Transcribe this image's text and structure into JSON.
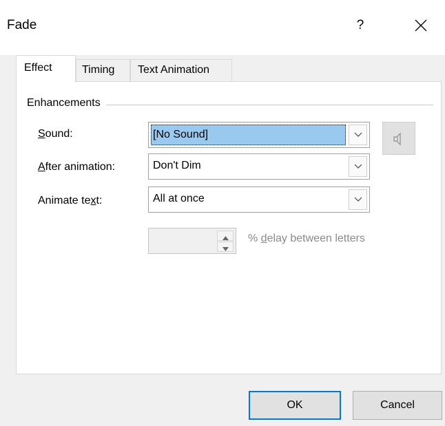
{
  "window": {
    "title": "Fade",
    "help_label": "?",
    "close_icon": "close-icon"
  },
  "tabs": [
    {
      "label": "Effect",
      "active": true
    },
    {
      "label": "Timing",
      "active": false
    },
    {
      "label": "Text Animation",
      "active": false
    }
  ],
  "enhancements": {
    "group_label": "Enhancements",
    "sound": {
      "label_prefix": "",
      "label_access": "S",
      "label_rest": "ound:",
      "value": "[No Sound]"
    },
    "after_animation": {
      "label_prefix": "",
      "label_access": "A",
      "label_rest": "fter animation:",
      "value": "Don't Dim"
    },
    "animate_text": {
      "label_prefix": "Animate te",
      "label_access": "x",
      "label_rest": "t:",
      "value": "All at once"
    },
    "delay": {
      "value": "",
      "label_prefix": "% ",
      "label_access": "d",
      "label_rest": "elay between letters"
    },
    "sound_button_icon": "speaker-icon"
  },
  "buttons": {
    "ok": "OK",
    "cancel": "Cancel"
  },
  "colors": {
    "accent": "#0078d7",
    "selection": "#99c9ef",
    "disabled_text": "#8a8a8a"
  }
}
